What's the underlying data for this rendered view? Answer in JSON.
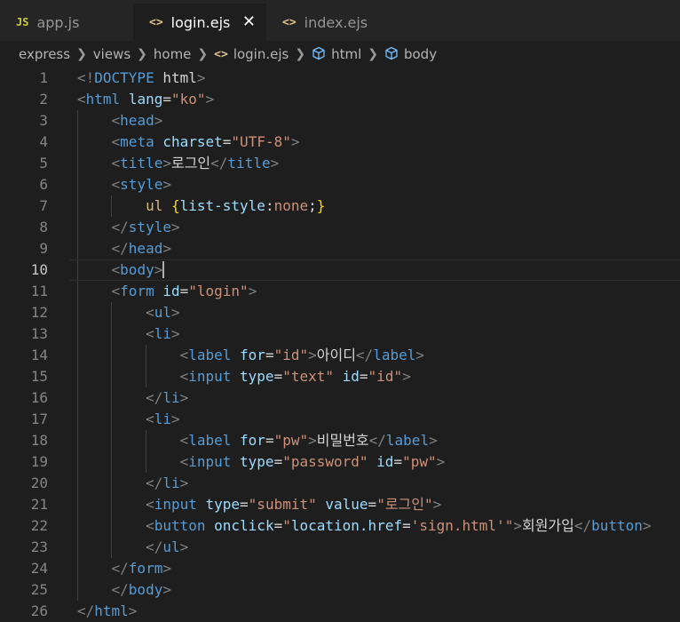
{
  "tabs": [
    {
      "icon": "JS",
      "label": "app.js",
      "active": false
    },
    {
      "icon": "<>",
      "label": "login.ejs",
      "active": true,
      "close": "✕"
    },
    {
      "icon": "<>",
      "label": "index.ejs",
      "active": false
    }
  ],
  "breadcrumb": [
    "express",
    "views",
    "home",
    "login.ejs",
    "html",
    "body"
  ],
  "editor": {
    "active_line": 10,
    "lines": [
      [
        [
          "p",
          "<!"
        ],
        [
          "t",
          "DOCTYPE "
        ],
        [
          "w",
          "html"
        ],
        [
          "p",
          ">"
        ]
      ],
      [
        [
          "p",
          "<"
        ],
        [
          "t",
          "html "
        ],
        [
          "a",
          "lang"
        ],
        [
          "w",
          "="
        ],
        [
          "s",
          "\"ko\""
        ],
        [
          "p",
          ">"
        ]
      ],
      [
        [
          "w",
          "    "
        ],
        [
          "p",
          "<"
        ],
        [
          "t",
          "head"
        ],
        [
          "p",
          ">"
        ]
      ],
      [
        [
          "w",
          "    "
        ],
        [
          "p",
          "<"
        ],
        [
          "t",
          "meta "
        ],
        [
          "a",
          "charset"
        ],
        [
          "w",
          "="
        ],
        [
          "s",
          "\"UTF-8\""
        ],
        [
          "p",
          ">"
        ]
      ],
      [
        [
          "w",
          "    "
        ],
        [
          "p",
          "<"
        ],
        [
          "t",
          "title"
        ],
        [
          "p",
          ">"
        ],
        [
          "w",
          "로그인"
        ],
        [
          "p",
          "</"
        ],
        [
          "t",
          "title"
        ],
        [
          "p",
          ">"
        ]
      ],
      [
        [
          "w",
          "    "
        ],
        [
          "p",
          "<"
        ],
        [
          "t",
          "style"
        ],
        [
          "p",
          ">"
        ]
      ],
      [
        [
          "w",
          "        "
        ],
        [
          "c",
          "ul "
        ],
        [
          "b",
          "{"
        ],
        [
          "a",
          "list-style"
        ],
        [
          "w",
          ":"
        ],
        [
          "s",
          "none"
        ],
        [
          "w",
          ";"
        ],
        [
          "b",
          "}"
        ]
      ],
      [
        [
          "w",
          "    "
        ],
        [
          "p",
          "</"
        ],
        [
          "t",
          "style"
        ],
        [
          "p",
          ">"
        ]
      ],
      [
        [
          "w",
          "    "
        ],
        [
          "p",
          "</"
        ],
        [
          "t",
          "head"
        ],
        [
          "p",
          ">"
        ]
      ],
      [
        [
          "w",
          "    "
        ],
        [
          "p",
          "<"
        ],
        [
          "t",
          "body"
        ],
        [
          "p",
          ">"
        ]
      ],
      [
        [
          "w",
          "    "
        ],
        [
          "p",
          "<"
        ],
        [
          "t",
          "form "
        ],
        [
          "a",
          "id"
        ],
        [
          "w",
          "="
        ],
        [
          "s",
          "\"login\""
        ],
        [
          "p",
          ">"
        ]
      ],
      [
        [
          "w",
          "        "
        ],
        [
          "p",
          "<"
        ],
        [
          "t",
          "ul"
        ],
        [
          "p",
          ">"
        ]
      ],
      [
        [
          "w",
          "        "
        ],
        [
          "p",
          "<"
        ],
        [
          "t",
          "li"
        ],
        [
          "p",
          ">"
        ]
      ],
      [
        [
          "w",
          "            "
        ],
        [
          "p",
          "<"
        ],
        [
          "t",
          "label "
        ],
        [
          "a",
          "for"
        ],
        [
          "w",
          "="
        ],
        [
          "s",
          "\"id\""
        ],
        [
          "p",
          ">"
        ],
        [
          "w",
          "아이디"
        ],
        [
          "p",
          "</"
        ],
        [
          "t",
          "label"
        ],
        [
          "p",
          ">"
        ]
      ],
      [
        [
          "w",
          "            "
        ],
        [
          "p",
          "<"
        ],
        [
          "t",
          "input "
        ],
        [
          "a",
          "type"
        ],
        [
          "w",
          "="
        ],
        [
          "s",
          "\"text\""
        ],
        [
          "w",
          " "
        ],
        [
          "a",
          "id"
        ],
        [
          "w",
          "="
        ],
        [
          "s",
          "\"id\""
        ],
        [
          "p",
          ">"
        ]
      ],
      [
        [
          "w",
          "        "
        ],
        [
          "p",
          "</"
        ],
        [
          "t",
          "li"
        ],
        [
          "p",
          ">"
        ]
      ],
      [
        [
          "w",
          "        "
        ],
        [
          "p",
          "<"
        ],
        [
          "t",
          "li"
        ],
        [
          "p",
          ">"
        ]
      ],
      [
        [
          "w",
          "            "
        ],
        [
          "p",
          "<"
        ],
        [
          "t",
          "label "
        ],
        [
          "a",
          "for"
        ],
        [
          "w",
          "="
        ],
        [
          "s",
          "\"pw\""
        ],
        [
          "p",
          ">"
        ],
        [
          "w",
          "비밀번호"
        ],
        [
          "p",
          "</"
        ],
        [
          "t",
          "label"
        ],
        [
          "p",
          ">"
        ]
      ],
      [
        [
          "w",
          "            "
        ],
        [
          "p",
          "<"
        ],
        [
          "t",
          "input "
        ],
        [
          "a",
          "type"
        ],
        [
          "w",
          "="
        ],
        [
          "s",
          "\"password\""
        ],
        [
          "w",
          " "
        ],
        [
          "a",
          "id"
        ],
        [
          "w",
          "="
        ],
        [
          "s",
          "\"pw\""
        ],
        [
          "p",
          ">"
        ]
      ],
      [
        [
          "w",
          "        "
        ],
        [
          "p",
          "</"
        ],
        [
          "t",
          "li"
        ],
        [
          "p",
          ">"
        ]
      ],
      [
        [
          "w",
          "        "
        ],
        [
          "p",
          "<"
        ],
        [
          "t",
          "input "
        ],
        [
          "a",
          "type"
        ],
        [
          "w",
          "="
        ],
        [
          "s",
          "\"submit\""
        ],
        [
          "w",
          " "
        ],
        [
          "a",
          "value"
        ],
        [
          "w",
          "="
        ],
        [
          "s",
          "\"로그인\""
        ],
        [
          "p",
          ">"
        ]
      ],
      [
        [
          "w",
          "        "
        ],
        [
          "p",
          "<"
        ],
        [
          "t",
          "button "
        ],
        [
          "a",
          "onclick"
        ],
        [
          "w",
          "="
        ],
        [
          "s",
          "\""
        ],
        [
          "a",
          "location.href"
        ],
        [
          "w",
          "="
        ],
        [
          "s",
          "'sign.html'"
        ],
        [
          "s",
          "\""
        ],
        [
          "p",
          ">"
        ],
        [
          "w",
          "회원가입"
        ],
        [
          "p",
          "</"
        ],
        [
          "t",
          "button"
        ],
        [
          "p",
          ">"
        ]
      ],
      [
        [
          "w",
          "        "
        ],
        [
          "p",
          "</"
        ],
        [
          "t",
          "ul"
        ],
        [
          "p",
          ">"
        ]
      ],
      [
        [
          "w",
          "    "
        ],
        [
          "p",
          "</"
        ],
        [
          "t",
          "form"
        ],
        [
          "p",
          ">"
        ]
      ],
      [
        [
          "w",
          "    "
        ],
        [
          "p",
          "</"
        ],
        [
          "t",
          "body"
        ],
        [
          "p",
          ">"
        ]
      ],
      [
        [
          "p",
          "</"
        ],
        [
          "t",
          "html"
        ],
        [
          "p",
          ">"
        ]
      ]
    ]
  },
  "colors": {
    "t": "#569cd6",
    "p": "#808080",
    "a": "#9cdcfe",
    "s": "#ce9178",
    "w": "#d4d4d4",
    "c": "#d7ba7d",
    "b": "#ffd700",
    "js_icon": "#cbcb41",
    "ejs_icon": "#e2c08d",
    "breadcrumb_icon": "#75beff"
  }
}
